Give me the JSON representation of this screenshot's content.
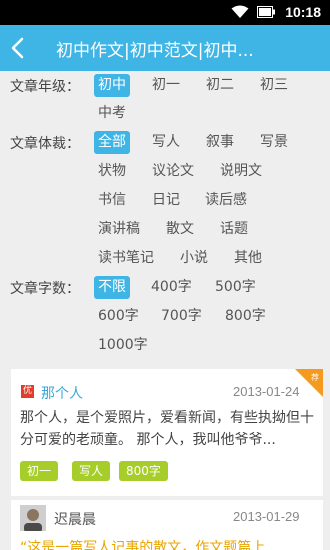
{
  "status_bar": {
    "time": "10:18"
  },
  "app_bar": {
    "title": "初中作文|初中范文|初中..."
  },
  "filters": {
    "grade": {
      "label": "文章年级：",
      "options": [
        "初中",
        "初一",
        "初二",
        "初三",
        "中考"
      ],
      "selected": "初中"
    },
    "genre": {
      "label": "文章体裁：",
      "options": [
        "全部",
        "写人",
        "叙事",
        "写景",
        "状物",
        "议论文",
        "说明文",
        "书信",
        "日记",
        "读后感",
        "演讲稿",
        "散文",
        "话题",
        "读书笔记",
        "小说",
        "其他"
      ],
      "selected": "全部"
    },
    "length": {
      "label": "文章字数：",
      "options": [
        "不限",
        "400字",
        "500字",
        "600字",
        "700字",
        "800字",
        "1000字"
      ],
      "selected": "不限"
    }
  },
  "articles": [
    {
      "badge": "优",
      "title": "那个人",
      "date": "2013-01-24",
      "ribbon": "荐",
      "excerpt": "那个人，是个爱照片，爱看新闻，有些执拗但十分可爱的老顽童。 那个人，我叫他爷爷...",
      "tags": [
        "初一",
        "写人",
        "800字"
      ]
    },
    {
      "author": "迟晨晨",
      "date": "2013-01-29",
      "excerpt": "“这是一篇写人记事的散文，作文题篇上"
    }
  ],
  "colors": {
    "accent": "#3fb5e6",
    "tag": "#a6cd2a",
    "badge": "#e03d2a",
    "ribbon": "#f39a1f"
  },
  "icons": [
    "wifi-icon",
    "battery-icon",
    "back-arrow-icon",
    "recommend-ribbon-icon",
    "excellent-badge-icon",
    "avatar"
  ]
}
